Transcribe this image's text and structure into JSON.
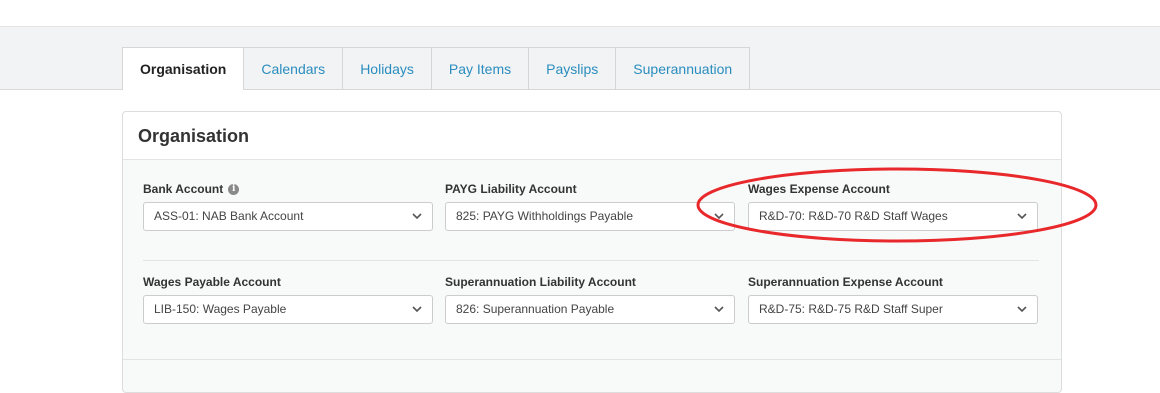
{
  "tabs": [
    {
      "label": "Organisation",
      "active": true
    },
    {
      "label": "Calendars",
      "active": false
    },
    {
      "label": "Holidays",
      "active": false
    },
    {
      "label": "Pay Items",
      "active": false
    },
    {
      "label": "Payslips",
      "active": false
    },
    {
      "label": "Superannuation",
      "active": false
    }
  ],
  "panel": {
    "title": "Organisation",
    "fields": {
      "bank_account": {
        "label": "Bank Account",
        "value": "ASS-01: NAB Bank Account",
        "info_icon": "info-icon"
      },
      "payg_liability": {
        "label": "PAYG Liability Account",
        "value": "825: PAYG Withholdings Payable"
      },
      "wages_expense": {
        "label": "Wages Expense Account",
        "value": "R&D-70: R&D-70 R&D Staff Wages"
      },
      "wages_payable": {
        "label": "Wages Payable Account",
        "value": "LIB-150: Wages Payable"
      },
      "super_liability": {
        "label": "Superannuation Liability Account",
        "value": "826: Superannuation Payable"
      },
      "super_expense": {
        "label": "Superannuation Expense Account",
        "value": "R&D-75: R&D-75 R&D Staff Super"
      }
    }
  },
  "colors": {
    "link": "#2a8dbf",
    "annotation": "#e8282b"
  }
}
